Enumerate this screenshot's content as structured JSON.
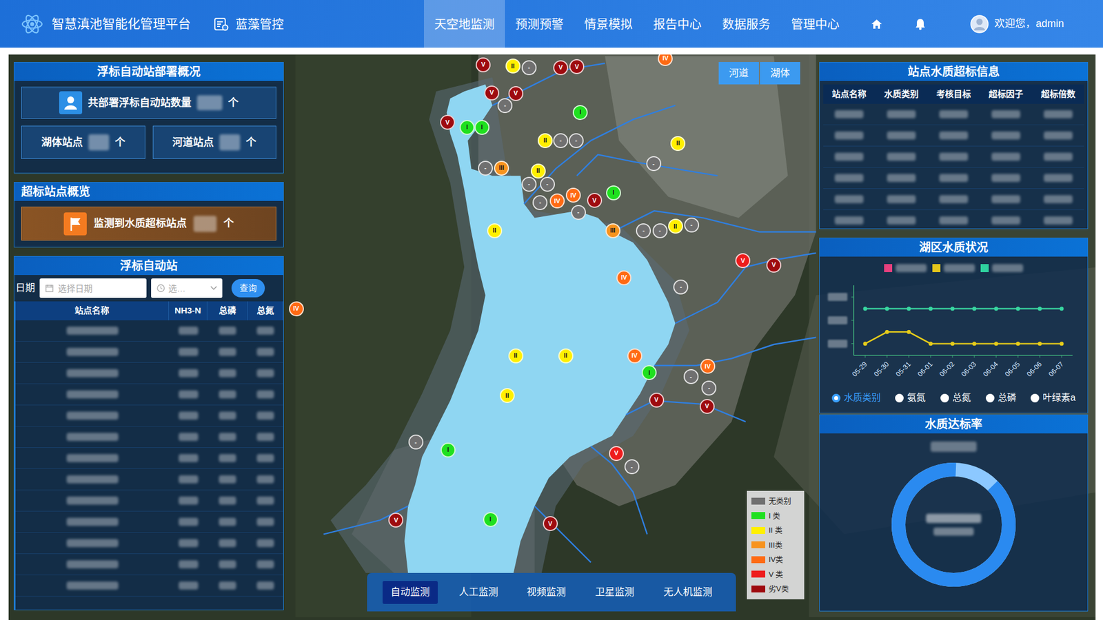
{
  "header": {
    "title": "智慧滇池智能化管理平台",
    "module": "蓝藻管控",
    "nav": [
      {
        "label": "天空地监测",
        "selected": true
      },
      {
        "label": "预测预警",
        "selected": false
      },
      {
        "label": "情景模拟",
        "selected": false
      },
      {
        "label": "报告中心",
        "selected": false
      },
      {
        "label": "数据服务",
        "selected": false
      },
      {
        "label": "管理中心",
        "selected": false
      }
    ],
    "welcome": "欢迎您，admin"
  },
  "map": {
    "toggle": [
      "河道",
      "湖体"
    ],
    "markers": [
      {
        "label": "V",
        "color": "#9e0b0f"
      },
      {
        "label": "II",
        "color": "#fff000"
      },
      {
        "label": "-",
        "color": "#707070"
      },
      {
        "label": "V",
        "color": "#9e0b0f"
      },
      {
        "label": "V",
        "color": "#9e0b0f"
      },
      {
        "label": "IV",
        "color": "#ff6a13"
      },
      {
        "label": "V",
        "color": "#9e0b0f"
      },
      {
        "label": "V",
        "color": "#9e0b0f"
      },
      {
        "label": "-",
        "color": "#707070"
      },
      {
        "label": "I",
        "color": "#1fe01f"
      },
      {
        "label": "V",
        "color": "#9e0b0f"
      },
      {
        "label": "I",
        "color": "#1fe01f"
      },
      {
        "label": "I",
        "color": "#1fe01f"
      },
      {
        "label": "II",
        "color": "#fff000"
      },
      {
        "label": "-",
        "color": "#707070"
      },
      {
        "label": "-",
        "color": "#707070"
      },
      {
        "label": "II",
        "color": "#fff000"
      },
      {
        "label": "-",
        "color": "#707070"
      },
      {
        "label": "III",
        "color": "#f7931e"
      },
      {
        "label": "-",
        "color": "#707070"
      },
      {
        "label": "II",
        "color": "#fff000"
      },
      {
        "label": "-",
        "color": "#707070"
      },
      {
        "label": "-",
        "color": "#707070"
      },
      {
        "label": "IV",
        "color": "#ff6a13"
      },
      {
        "label": "IV",
        "color": "#ff6a13"
      },
      {
        "label": "-",
        "color": "#707070"
      },
      {
        "label": "V",
        "color": "#9e0b0f"
      },
      {
        "label": "I",
        "color": "#1fe01f"
      },
      {
        "label": "-",
        "color": "#707070"
      },
      {
        "label": "II",
        "color": "#fff000"
      },
      {
        "label": "III",
        "color": "#f7931e"
      },
      {
        "label": "-",
        "color": "#707070"
      },
      {
        "label": "-",
        "color": "#707070"
      },
      {
        "label": "II",
        "color": "#fff000"
      },
      {
        "label": "-",
        "color": "#707070"
      },
      {
        "label": "V",
        "color": "#ee1c1c"
      },
      {
        "label": "V",
        "color": "#9e0b0f"
      },
      {
        "label": "IV",
        "color": "#ff6a13"
      },
      {
        "label": "-",
        "color": "#707070"
      },
      {
        "label": "IV",
        "color": "#ff6a13"
      },
      {
        "label": "II",
        "color": "#fff000"
      },
      {
        "label": "II",
        "color": "#fff000"
      },
      {
        "label": "IV",
        "color": "#ff6a13"
      },
      {
        "label": "I",
        "color": "#1fe01f"
      },
      {
        "label": "-",
        "color": "#707070"
      },
      {
        "label": "IV",
        "color": "#ff6a13"
      },
      {
        "label": "-",
        "color": "#707070"
      },
      {
        "label": "II",
        "color": "#fff000"
      },
      {
        "label": "V",
        "color": "#9e0b0f"
      },
      {
        "label": "V",
        "color": "#9e0b0f"
      },
      {
        "label": "-",
        "color": "#707070"
      },
      {
        "label": "I",
        "color": "#1fe01f"
      },
      {
        "label": "V",
        "color": "#ee1c1c"
      },
      {
        "label": "-",
        "color": "#707070"
      },
      {
        "label": "V",
        "color": "#9e0b0f"
      },
      {
        "label": "I",
        "color": "#1fe01f"
      },
      {
        "label": "V",
        "color": "#9e0b0f"
      }
    ],
    "legend": [
      {
        "label": "无类别",
        "color": "#707070"
      },
      {
        "label": "I 类",
        "color": "#1fe01f"
      },
      {
        "label": "II 类",
        "color": "#fff000"
      },
      {
        "label": "III类",
        "color": "#f7931e"
      },
      {
        "label": "IV类",
        "color": "#ff6a13"
      },
      {
        "label": "V 类",
        "color": "#ee1c1c"
      },
      {
        "label": "劣V类",
        "color": "#9e0b0f"
      }
    ],
    "monitor_tabs": [
      {
        "label": "自动监测",
        "selected": true
      },
      {
        "label": "人工监测",
        "selected": false
      },
      {
        "label": "视频监测",
        "selected": false
      },
      {
        "label": "卫星监测",
        "selected": false
      },
      {
        "label": "无人机监测",
        "selected": false
      }
    ]
  },
  "deployment": {
    "title": "浮标自动站部署概况",
    "total_label": "共部署浮标自动站数量",
    "total_unit": "个",
    "lake_label": "湖体站点",
    "lake_unit": "个",
    "river_label": "河道站点",
    "river_unit": "个"
  },
  "exceed": {
    "title": "超标站点概览",
    "label": "监测到水质超标站点",
    "unit": "个"
  },
  "buoy": {
    "title": "浮标自动站",
    "date_label": "日期",
    "date_placeholder": "选择日期",
    "time_placeholder": "选…",
    "query": "查询",
    "columns": [
      "站点名称",
      "NH3-N",
      "总磷",
      "总氮"
    ]
  },
  "exceed_info": {
    "title": "站点水质超标信息",
    "columns": [
      "站点名称",
      "水质类别",
      "考核目标",
      "超标因子",
      "超标倍数"
    ]
  },
  "lake_status": {
    "title": "湖区水质状况",
    "legend": [
      {
        "color": "#e8407e"
      },
      {
        "color": "#e3c51b"
      },
      {
        "color": "#2fd3a0"
      }
    ],
    "x_labels": [
      "05-29",
      "05-30",
      "05-31",
      "06-01",
      "06-02",
      "06-03",
      "06-04",
      "06-05",
      "06-06",
      "06-07"
    ],
    "series": [
      {
        "color": "#38d6a0",
        "values": [
          4,
          4,
          4,
          4,
          4,
          4,
          4,
          4,
          4,
          4
        ]
      },
      {
        "color": "#e6cc1a",
        "values": [
          1,
          2,
          2,
          1,
          1,
          1,
          1,
          1,
          1,
          1
        ]
      }
    ],
    "options": [
      {
        "label": "水质类别",
        "selected": true
      },
      {
        "label": "氨氮",
        "selected": false
      },
      {
        "label": "总氮",
        "selected": false
      },
      {
        "label": "总磷",
        "selected": false
      },
      {
        "label": "叶绿素a",
        "selected": false
      }
    ]
  },
  "rate": {
    "title": "水质达标率",
    "level": 0.88
  }
}
